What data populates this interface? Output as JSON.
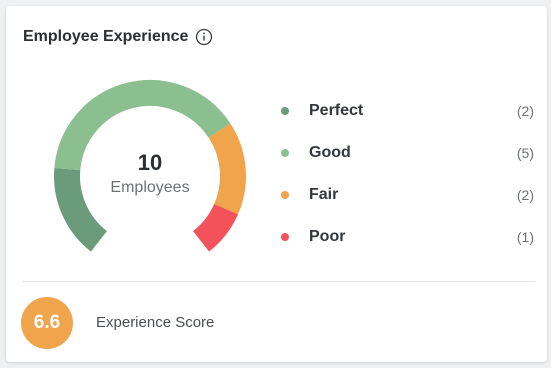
{
  "widget": {
    "title": "Employee Experience",
    "info_icon": "info-icon"
  },
  "gauge": {
    "count": "10",
    "label": "Employees"
  },
  "legend": [
    {
      "label": "Perfect",
      "count": "(2)",
      "value": 2,
      "color": "#6a9b7a"
    },
    {
      "label": "Good",
      "count": "(5)",
      "value": 5,
      "color": "#8cbf8f"
    },
    {
      "label": "Fair",
      "count": "(2)",
      "value": 2,
      "color": "#f0a54c"
    },
    {
      "label": "Poor",
      "count": "(1)",
      "value": 1,
      "color": "#f4525a"
    }
  ],
  "score": {
    "value": "6.6",
    "label": "Experience Score",
    "color": "#f0a54c"
  }
}
